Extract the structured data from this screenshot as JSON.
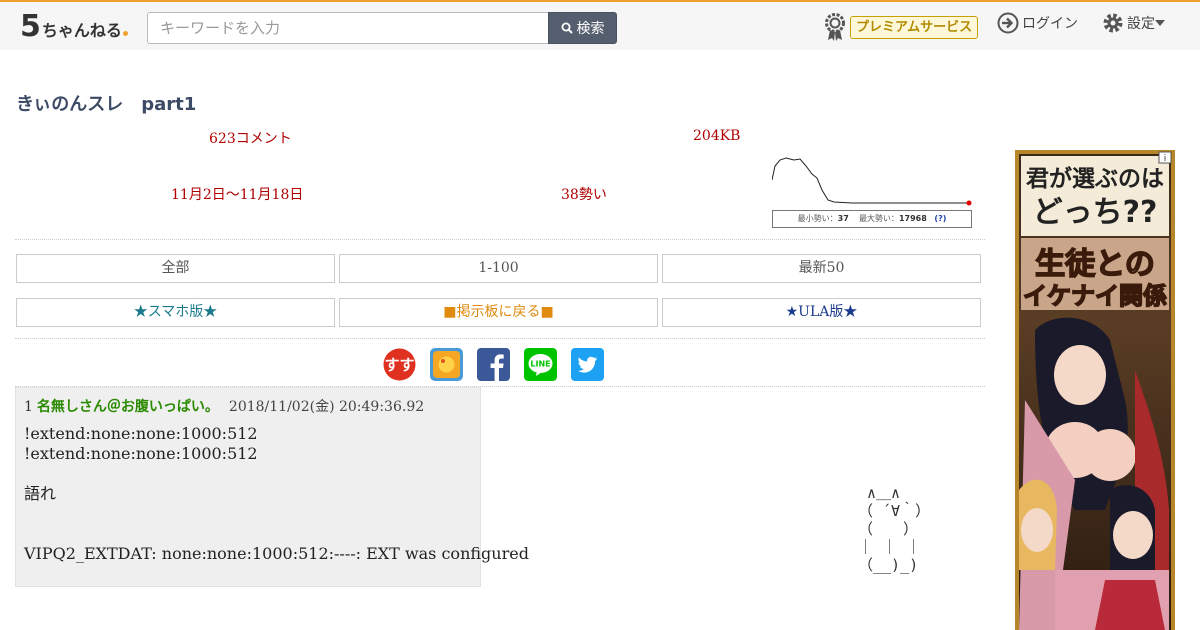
{
  "header": {
    "logo_number": "5",
    "logo_text": "ちゃんねる",
    "search_placeholder": "キーワードを入力",
    "search_button": "検索",
    "premium_label": "プレミアムサービス",
    "login_label": "ログイン",
    "settings_label": "設定"
  },
  "thread": {
    "title": "きぃのんスレ　part1",
    "comments": "623コメント",
    "size": "204KB",
    "period": "11月2日〜11月18日",
    "momentum": "38勢い"
  },
  "momentum_graph": {
    "caption_min_label": "最小勢い：",
    "caption_min_value": "37",
    "caption_max_label": "最大勢い：",
    "caption_max_value": "17968",
    "caption_help": "(?)",
    "line_color": "#222222",
    "end_marker_color": "#e00000"
  },
  "nav": {
    "all": "全部",
    "range": "1-100",
    "latest": "最新50",
    "smartphone": "★スマホ版★",
    "back_to_board": "■掲示板に戻る■",
    "ula": "★ULA版★"
  },
  "share": {
    "items": [
      "susu-icon",
      "bookmark-app-icon",
      "facebook-icon",
      "line-icon",
      "twitter-icon"
    ],
    "line_text": "LINE"
  },
  "post": {
    "number": "1",
    "name": "名無しさん＠お腹いっぱい。",
    "date": "2018/11/02(金) 20:49:36.92",
    "body": "!extend:none:none:1000:512\n!extend:none:none:1000:512\n\n語れ\n\n\nVIPQ2_EXTDAT: none:none:1000:512:----: EXT was configured"
  },
  "ascii_art": " ∧＿∧\n（ ´∀｀）\n（　　）\n｜ ｜ ｜\n（__)_)",
  "ad": {
    "line1": "君が選ぶのは",
    "line2": "どっち??",
    "line3": "生徒との",
    "line4": "イケナイ関係",
    "info_icon": "i"
  },
  "colors": {
    "accent_orange": "#f0a030",
    "meta_red": "#b00000",
    "name_green": "#2a8a00",
    "title_navy": "#3c4a66"
  }
}
